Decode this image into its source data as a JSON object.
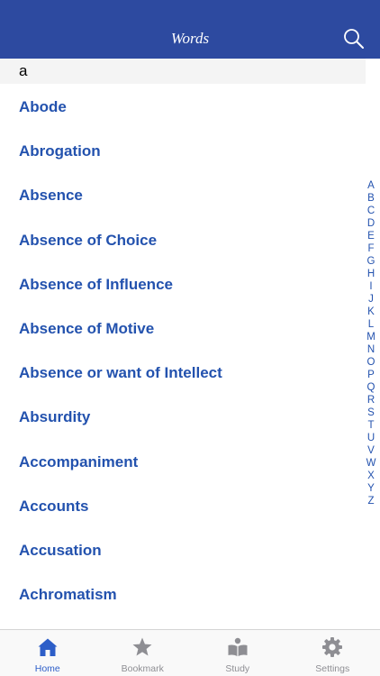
{
  "navbar": {
    "title": "Words",
    "search_icon": "search-icon"
  },
  "section": {
    "header": "a"
  },
  "words": [
    "Abode",
    "Abrogation",
    "Absence",
    "Absence of Choice",
    "Absence of Influence",
    "Absence of Motive",
    "Absence or want of Intellect",
    "Absurdity",
    "Accompaniment",
    "Accounts",
    "Accusation",
    "Achromatism"
  ],
  "alpha_index": [
    "A",
    "B",
    "C",
    "D",
    "E",
    "F",
    "G",
    "H",
    "I",
    "J",
    "K",
    "L",
    "M",
    "N",
    "O",
    "P",
    "Q",
    "R",
    "S",
    "T",
    "U",
    "V",
    "W",
    "X",
    "Y",
    "Z"
  ],
  "tabs": [
    {
      "label": "Home",
      "icon": "home-icon",
      "active": true
    },
    {
      "label": "Bookmark",
      "icon": "star-icon",
      "active": false
    },
    {
      "label": "Study",
      "icon": "reader-icon",
      "active": false
    },
    {
      "label": "Settings",
      "icon": "gear-icon",
      "active": false
    }
  ],
  "colors": {
    "nav_background": "#2d4aa0",
    "word_text": "#2352ae",
    "tab_active": "#2d5ec8",
    "tab_inactive": "#8e8e93"
  }
}
